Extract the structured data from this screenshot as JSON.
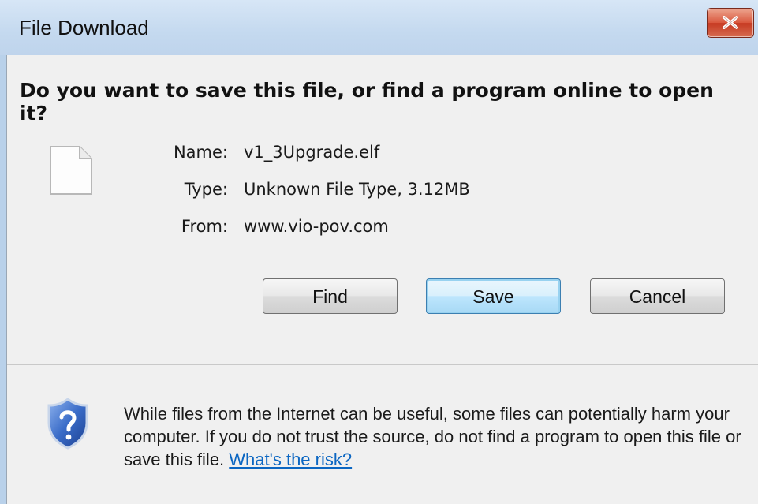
{
  "window": {
    "title": "File Download"
  },
  "heading": "Do you want to save this file, or find a program online to open it?",
  "file_info": {
    "name_label": "Name:",
    "name_value": "v1_3Upgrade.elf",
    "type_label": "Type:",
    "type_value": "Unknown File Type, 3.12MB",
    "from_label": "From:",
    "from_value": "www.vio-pov.com"
  },
  "buttons": {
    "find": "Find",
    "save": "Save",
    "cancel": "Cancel"
  },
  "warning": {
    "text": "While files from the Internet can be useful, some files can potentially harm your computer. If you do not trust the source, do not find a program to open this file or save this file.",
    "link": "What's the risk?"
  },
  "icons": {
    "file": "blank-file-icon",
    "shield": "security-shield-question-icon",
    "close": "close-icon"
  },
  "colors": {
    "titlebar": "#c4d9ef",
    "close_button": "#d9573d",
    "link": "#0b66c2",
    "shield": "#2f5fb3"
  }
}
